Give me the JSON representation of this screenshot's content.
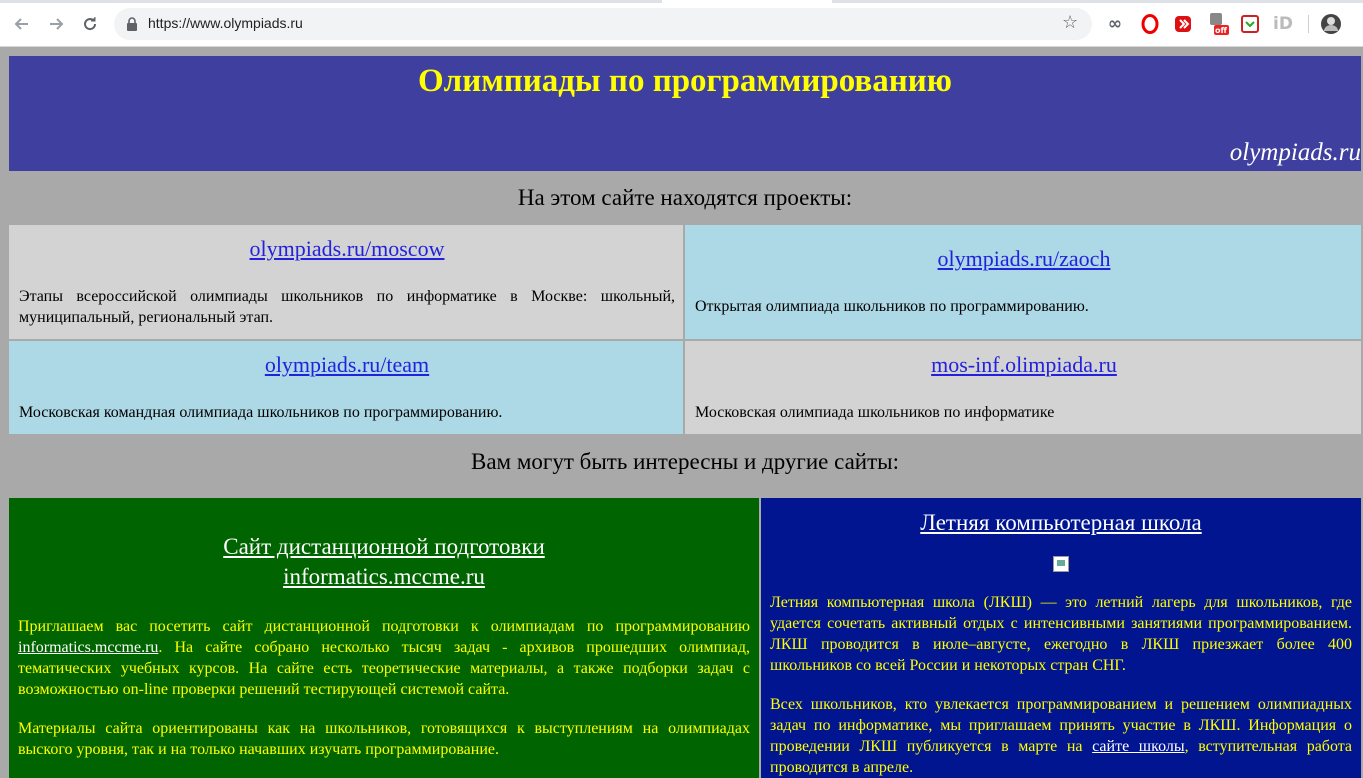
{
  "browser": {
    "url": "https://www.olympiads.ru",
    "back_icon": "arrow-left-icon",
    "forward_icon": "arrow-right-icon",
    "reload_icon": "reload-icon",
    "badge_off": "off"
  },
  "banner": {
    "title": "Олимпиады по программированию",
    "domain": "olympiads.ru",
    "bg_color": "#3f3f9f",
    "title_color": "#ffff00"
  },
  "projects": {
    "heading": "На этом сайте находятся проекты:",
    "items": [
      {
        "link": "olympiads.ru/moscow",
        "desc": "Этапы всероссийской олимпиады школьников по информатике в Москве: школьный, муниципальный, региональный этап."
      },
      {
        "link": "olympiads.ru/zaoch",
        "desc": "Открытая олимпиада школьников по программированию."
      },
      {
        "link": "olympiads.ru/team",
        "desc": "Московская командная олимпиада школьников по программированию."
      },
      {
        "link": "mos-inf.olimpiada.ru",
        "desc": "Московская олимпиада школьников по информатике"
      }
    ]
  },
  "others": {
    "heading": "Вам могут быть интересны и другие сайты:",
    "informatics": {
      "title_line1": "Сайт дистанционной подготовки",
      "title_line2": "informatics.mccme.ru",
      "p1_before": "Приглашаем вас посетить сайт дистанционной подготовки к олимпиадам по программированию ",
      "p1_link": "informatics.mccme.ru",
      "p1_after": ". На сайте собрано несколько тысяч задач - архивов прошедших олимпиад, тематических учебных курсов. На сайте есть теоретические материалы, а также подборки задач с возможностью on-line проверки решений тестирующей системой сайта.",
      "p2": "Материалы сайта ориентированы как на школьников, готовящихся к выступлениям на олимпиадах выского уровня, так и на только начавших изучать программирование."
    },
    "lksh": {
      "title": "Летняя компьютерная школа",
      "p1": "Летняя компьютерная школа (ЛКШ) — это летний лагерь для школьников, где удается сочетать активный отдых с интенсивными занятиями программированием. ЛКШ проводится в июле–августе, ежегодно в ЛКШ приезжает более 400 школьников со всей России и некоторых стран СНГ.",
      "p2_before": "Всех школьников, кто увлекается программированием и решением олимпиадных задач по информатике, мы приглашаем принять участие в ЛКШ. Информация о проведении ЛКШ публикуется в марте на ",
      "p2_link": "сайте школы",
      "p2_after": ", вступительная работа проводится в апреле."
    }
  }
}
